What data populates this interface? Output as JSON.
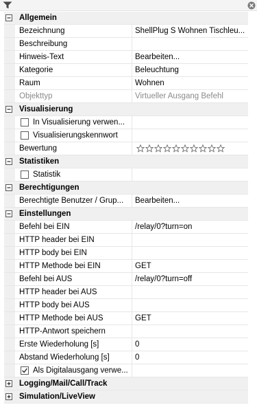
{
  "toolbar": {
    "filter_icon": "filter-icon",
    "close_icon": "close-icon"
  },
  "categories": [
    {
      "key": "allgemein",
      "label": "Allgemein",
      "expanded": true,
      "rows": [
        {
          "name": "Bezeichnung",
          "value": "ShellPlug S Wohnen Tischleu..."
        },
        {
          "name": "Beschreibung",
          "value": ""
        },
        {
          "name": "Hinweis-Text",
          "value": "Bearbeiten..."
        },
        {
          "name": "Kategorie",
          "value": "Beleuchtung"
        },
        {
          "name": "Raum",
          "value": "Wohnen"
        },
        {
          "name": "Objekttyp",
          "value": "Virtueller Ausgang Befehl",
          "readonly": true
        }
      ]
    },
    {
      "key": "visualisierung",
      "label": "Visualisierung",
      "expanded": true,
      "rows": [
        {
          "name": "In Visualisierung verwen...",
          "value": "",
          "checkbox": true,
          "checked": false
        },
        {
          "name": "Visualisierungskennwort",
          "value": "",
          "checkbox": true,
          "checked": false
        },
        {
          "name": "Bewertung",
          "value": "",
          "rating": 0,
          "rating_max": 10
        }
      ]
    },
    {
      "key": "statistiken",
      "label": "Statistiken",
      "expanded": true,
      "rows": [
        {
          "name": "Statistik",
          "value": "",
          "checkbox": true,
          "checked": false
        }
      ]
    },
    {
      "key": "berechtigungen",
      "label": "Berechtigungen",
      "expanded": true,
      "rows": [
        {
          "name": "Berechtigte Benutzer / Grup...",
          "value": "Bearbeiten..."
        }
      ]
    },
    {
      "key": "einstellungen",
      "label": "Einstellungen",
      "expanded": true,
      "rows": [
        {
          "name": "Befehl bei EIN",
          "value": "/relay/0?turn=on"
        },
        {
          "name": "HTTP header bei EIN",
          "value": ""
        },
        {
          "name": "HTTP body bei EIN",
          "value": ""
        },
        {
          "name": "HTTP Methode bei EIN",
          "value": "GET"
        },
        {
          "name": "Befehl bei AUS",
          "value": "/relay/0?turn=off"
        },
        {
          "name": "HTTP header bei AUS",
          "value": ""
        },
        {
          "name": "HTTP body bei AUS",
          "value": ""
        },
        {
          "name": "HTTP Methode bei AUS",
          "value": "GET"
        },
        {
          "name": "HTTP-Antwort speichern",
          "value": ""
        },
        {
          "name": "Erste Wiederholung [s]",
          "value": "0"
        },
        {
          "name": "Abstand Wiederholung [s]",
          "value": "0"
        },
        {
          "name": "Als Digitalausgang verwe...",
          "value": "",
          "checkbox": true,
          "checked": true
        }
      ]
    },
    {
      "key": "logging",
      "label": "Logging/Mail/Call/Track",
      "expanded": false,
      "rows": []
    },
    {
      "key": "simulation",
      "label": "Simulation/LiveView",
      "expanded": false,
      "rows": []
    }
  ]
}
